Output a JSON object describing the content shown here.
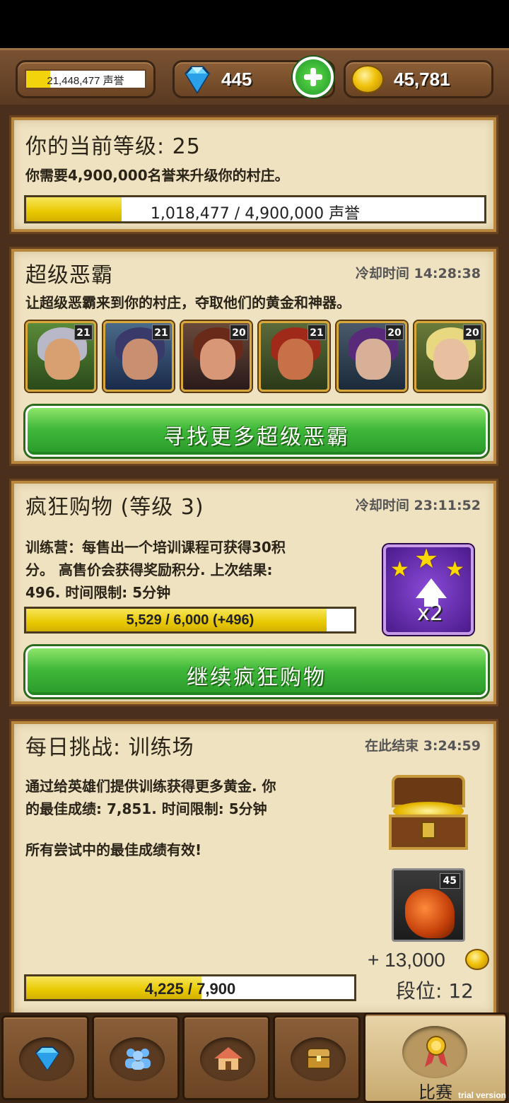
{
  "topbar": {
    "fame_text": "21,448,477 声誉",
    "fame_fill": 0.2,
    "gems": "445",
    "gold": "45,781"
  },
  "level_panel": {
    "title": "你的当前等级: 25",
    "desc": "你需要4,900,000名誉来升级你的村庄。",
    "progress_text": "1,018,477 / 4,900,000 声誉",
    "progress": 0.208
  },
  "bully_panel": {
    "title": "超级恶霸",
    "timer": "冷却时间 14:28:38",
    "desc": "让超级恶霸来到你的村庄，夺取他们的黄金和神器。",
    "heroes": [
      {
        "level": "21"
      },
      {
        "level": "21"
      },
      {
        "level": "20"
      },
      {
        "level": "21"
      },
      {
        "level": "20"
      },
      {
        "level": "20"
      }
    ],
    "button": "寻找更多超级恶霸"
  },
  "shopping_panel": {
    "title": "疯狂购物 (等级 3)",
    "timer": "冷却时间 23:11:52",
    "desc_line1": "训练营：每售出一个培训课程可获得30积",
    "desc_line2": "分。 高售价会获得奖励积分. 上次结果:",
    "desc_line3": "496. 时间限制: 5分钟",
    "progress_text": "5,529 / 6,000 (+496)",
    "progress": 0.915,
    "boost_label": "x2",
    "button": "继续疯狂购物"
  },
  "daily_panel": {
    "title": "每日挑战: 训练场",
    "timer": "在此结束 3:24:59",
    "desc_line1": "通过给英雄们提供训练获得更多黄金. 你",
    "desc_line2": "的最佳成绩: 7,851. 时间限制: 5分钟",
    "desc_line3": "所有尝试中的最佳成绩有效!",
    "progress_text": "4,225 / 7,900",
    "progress": 0.535,
    "dragon_level": "45",
    "reward": "+ 13,000",
    "rank": "段位: 12"
  },
  "nav": {
    "active_label": "比赛"
  },
  "watermark": "trial version"
}
